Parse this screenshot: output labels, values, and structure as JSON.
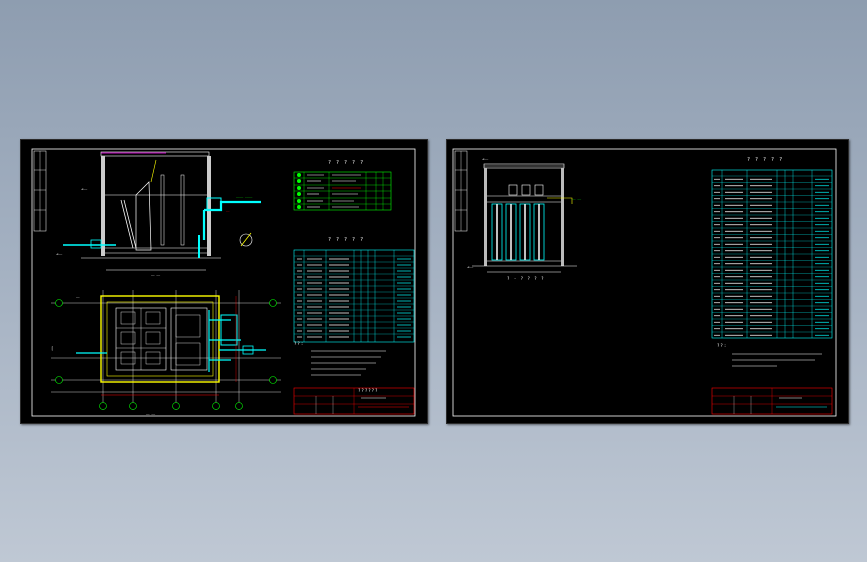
{
  "sheets": [
    {
      "name": "sheet-1"
    },
    {
      "name": "sheet-2"
    }
  ],
  "sheet1": {
    "tables": {
      "equipment_title": "? ? ? ? ?",
      "materials_title": "? ? ? ? ?"
    },
    "title_block_label": "??????",
    "notes_label": "??:"
  },
  "sheet2": {
    "table_title": "? ? ? ? ?",
    "section_label": "? - ? ? ? ?",
    "notes_label": "??:"
  },
  "colors": {
    "background": "#000000",
    "frame": "#ffffff",
    "cad_cyan": "#00ffff",
    "cad_green": "#00ff00",
    "cad_yellow": "#ffff00",
    "cad_red": "#ff0000",
    "cad_magenta": "#ff00ff"
  }
}
